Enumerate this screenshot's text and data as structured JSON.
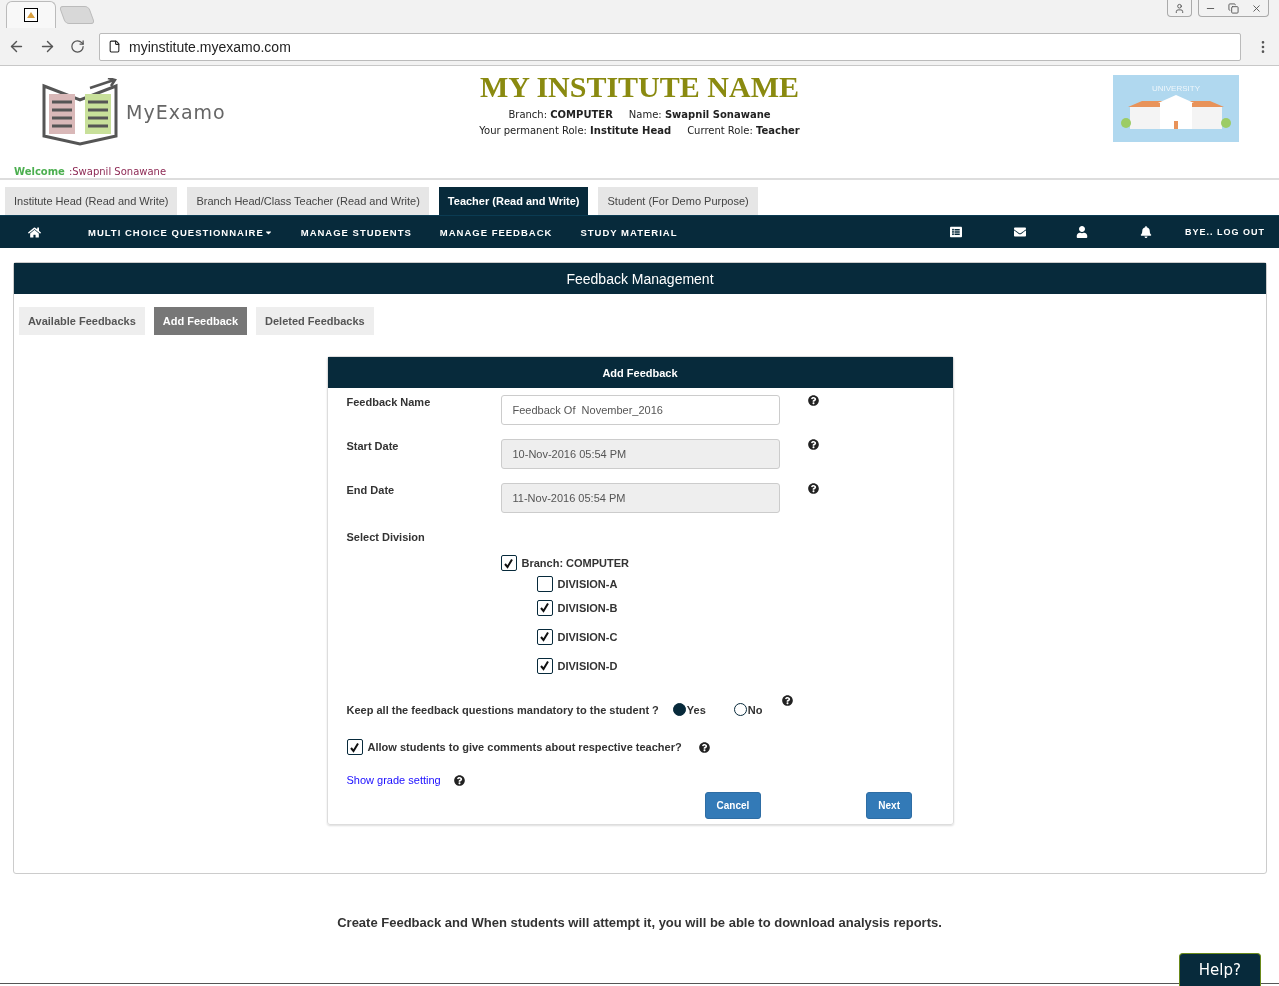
{
  "browser": {
    "url": "myinstitute.myexamo.com"
  },
  "header": {
    "logo_text": "MyExamo",
    "institute_name": "MY INSTITUTE NAME",
    "info_rows": [
      [
        {
          "label": "Branch:",
          "value": "COMPUTER"
        },
        {
          "label": "Name:",
          "value": "Swapnil Sonawane"
        }
      ],
      [
        {
          "label": "Your permanent Role:",
          "value": "Institute Head"
        },
        {
          "label": "Current Role:",
          "value": "Teacher"
        }
      ]
    ],
    "banner_label": "UNIVERSITY",
    "welcome_label": "Welcome",
    "welcome_name": ":Swapnil Sonawane"
  },
  "role_tabs": [
    {
      "label": "Institute Head (Read and Write)",
      "selected": false
    },
    {
      "label": "Branch Head/Class Teacher (Read and Write)",
      "selected": false
    },
    {
      "label": "Teacher (Read and Write)",
      "selected": true
    },
    {
      "label": "Student (For Demo Purpose)",
      "selected": false
    }
  ],
  "nav": {
    "items": [
      {
        "label": "MULTI CHOICE QUESTIONNAIRE",
        "kind": "dropdown"
      },
      {
        "label": "MANAGE STUDENTS",
        "kind": "link"
      },
      {
        "label": "MANAGE FEEDBACK",
        "kind": "link"
      },
      {
        "label": "STUDY MATERIAL",
        "kind": "link"
      }
    ],
    "logout": "BYE.. LOG OUT"
  },
  "panel": {
    "title": "Feedback Management",
    "tabs": [
      {
        "label": "Available Feedbacks",
        "selected": false
      },
      {
        "label": "Add Feedback",
        "selected": true
      },
      {
        "label": "Deleted Feedbacks",
        "selected": false
      }
    ],
    "form": {
      "title": "Add Feedback",
      "fields": [
        {
          "label": "Feedback Name",
          "value": "Feedback Of  November_2016",
          "kind": "text"
        },
        {
          "label": "Start Date",
          "value": "10-Nov-2016 05:54 PM",
          "kind": "readonly"
        },
        {
          "label": "End Date",
          "value": "11-Nov-2016 05:54 PM",
          "kind": "readonly"
        }
      ],
      "division_label": "Select Division",
      "branch": {
        "label": "Branch: COMPUTER",
        "checked": true,
        "children": [
          {
            "label": "DIVISION-A",
            "checked": false
          },
          {
            "label": "DIVISION-B",
            "checked": true
          },
          {
            "label": "DIVISION-C",
            "checked": true
          },
          {
            "label": "DIVISION-D",
            "checked": true
          }
        ]
      },
      "mandatory": {
        "question": "Keep all the feedback questions mandatory to the student ?",
        "options": [
          {
            "label": "Yes",
            "selected": true
          },
          {
            "label": "No",
            "selected": false
          }
        ]
      },
      "allow_comments": {
        "label": "Allow students to give comments about respective teacher?",
        "checked": true
      },
      "grade_link": "Show grade setting",
      "buttons": [
        "Cancel",
        "Next"
      ]
    }
  },
  "footer_note": "Create Feedback and When students will attempt it, you will be able to download analysis reports.",
  "help_button": "Help?"
}
